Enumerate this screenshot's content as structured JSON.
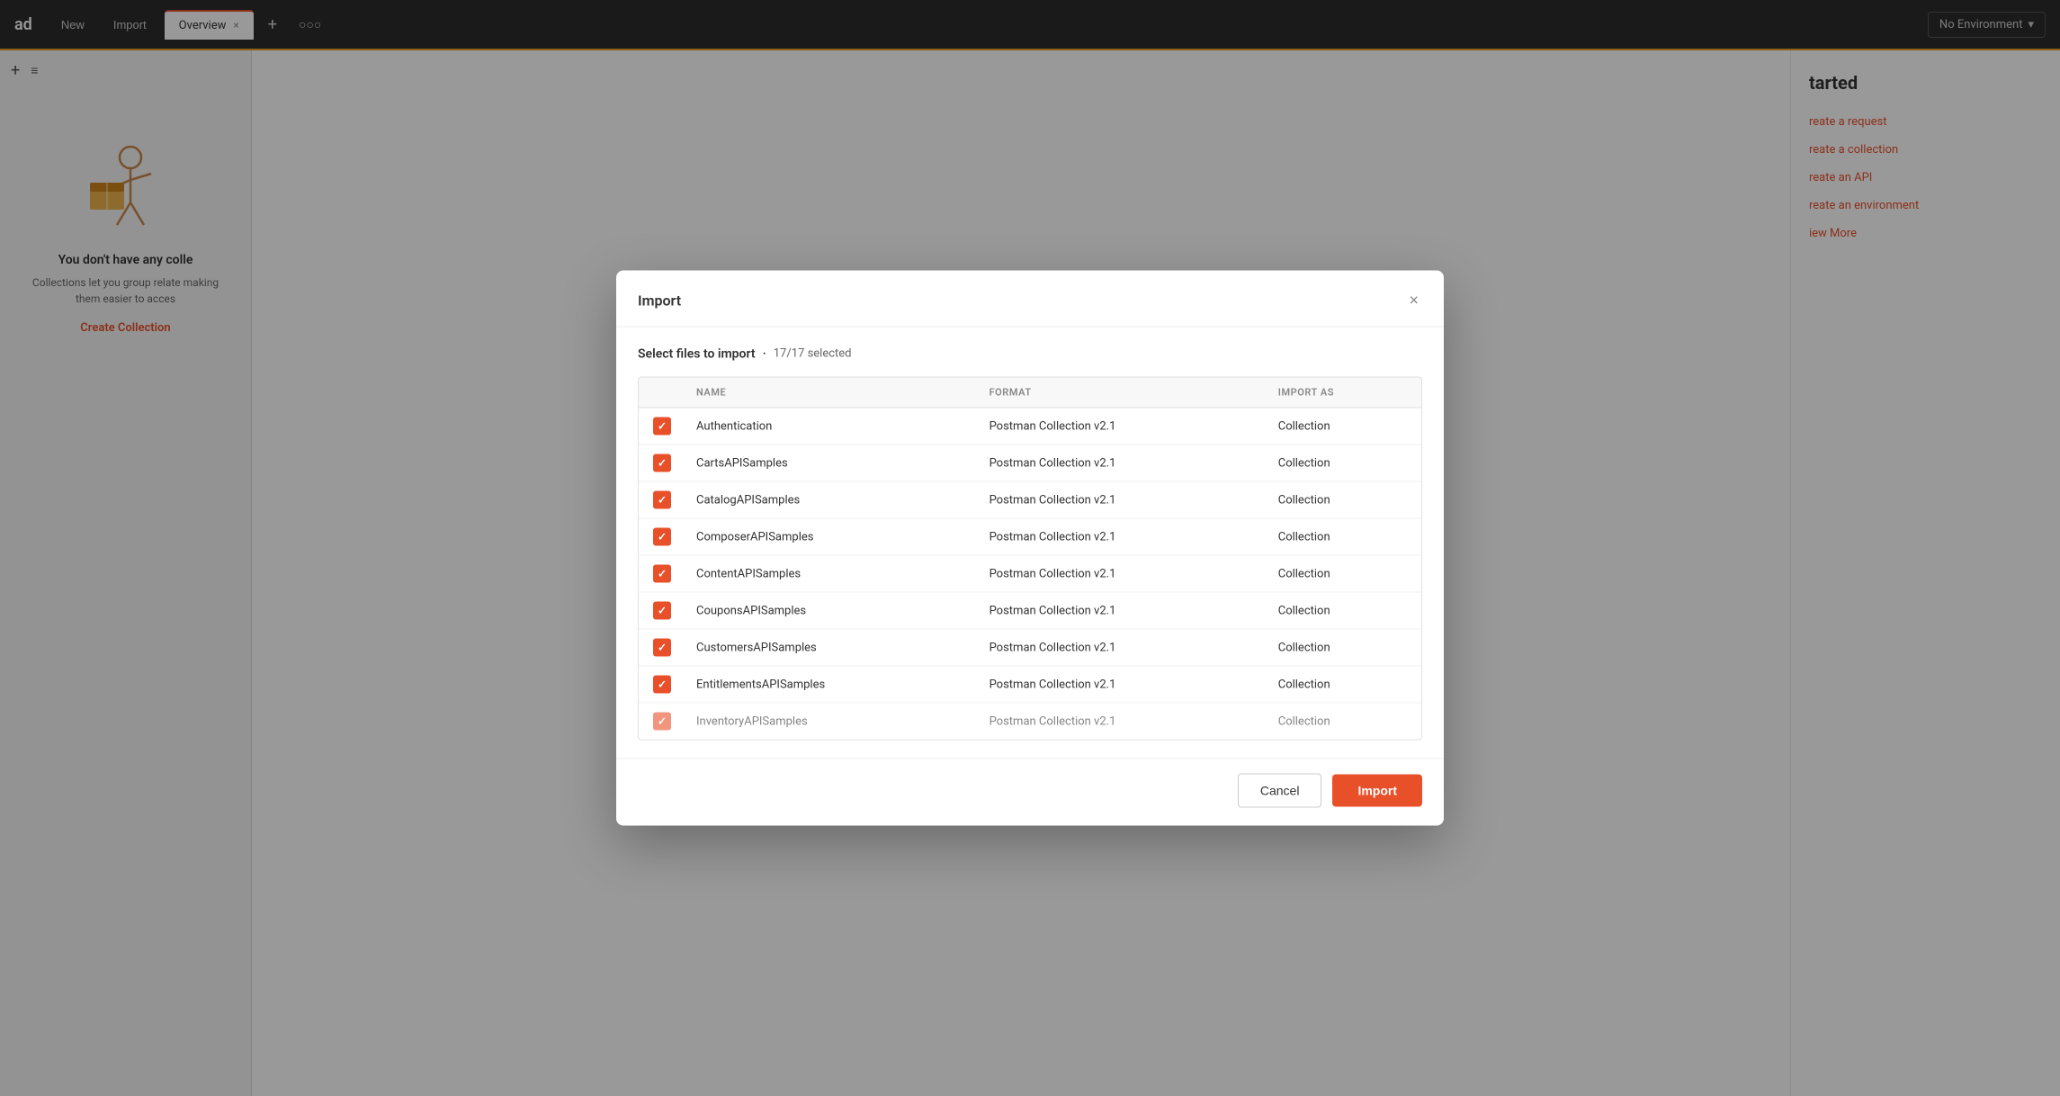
{
  "app": {
    "brand": "ad",
    "tab_new": "New",
    "tab_import": "Import",
    "tab_overview": "Overview",
    "tab_add_icon": "+",
    "tab_more_icon": "○○○",
    "env_selector": "No Environment",
    "env_dropdown_icon": "▾"
  },
  "sidebar": {
    "plus_icon": "+",
    "filter_icon": "≡",
    "empty_title": "You don't have any colle",
    "empty_desc": "Collections let you group relate\nmaking them easier to acces",
    "create_collection": "Create Collection"
  },
  "right_panel": {
    "title": "tarted",
    "items": [
      "reate a request",
      "reate a collection",
      "reate an API",
      "reate an environment",
      "iew More"
    ]
  },
  "modal": {
    "title": "Import",
    "close_icon": "×",
    "select_files_label": "Select files to import",
    "separator": "·",
    "selected_count": "17/17 selected",
    "table": {
      "columns": [
        "NAME",
        "FORMAT",
        "IMPORT AS"
      ],
      "rows": [
        {
          "name": "Authentication",
          "format": "Postman Collection v2.1",
          "import_as": "Collection",
          "checked": true
        },
        {
          "name": "CartsAPISamples",
          "format": "Postman Collection v2.1",
          "import_as": "Collection",
          "checked": true
        },
        {
          "name": "CatalogAPISamples",
          "format": "Postman Collection v2.1",
          "import_as": "Collection",
          "checked": true
        },
        {
          "name": "ComposerAPISamples",
          "format": "Postman Collection v2.1",
          "import_as": "Collection",
          "checked": true
        },
        {
          "name": "ContentAPISamples",
          "format": "Postman Collection v2.1",
          "import_as": "Collection",
          "checked": true
        },
        {
          "name": "CouponsAPISamples",
          "format": "Postman Collection v2.1",
          "import_as": "Collection",
          "checked": true
        },
        {
          "name": "CustomersAPISamples",
          "format": "Postman Collection v2.1",
          "import_as": "Collection",
          "checked": true
        },
        {
          "name": "EntitlementsAPISamples",
          "format": "Postman Collection v2.1",
          "import_as": "Collection",
          "checked": true
        },
        {
          "name": "InventoryAPISamples",
          "format": "Postman Collection v2.1",
          "import_as": "Collection",
          "checked": true
        }
      ]
    },
    "cancel_label": "Cancel",
    "import_label": "Import",
    "colors": {
      "accent": "#e8502a",
      "checkbox_bg": "#e8502a"
    }
  }
}
